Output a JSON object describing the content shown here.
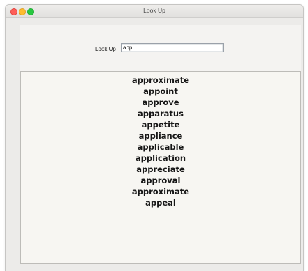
{
  "window": {
    "title": "Look Up"
  },
  "lookup": {
    "label": "Look Up",
    "value": "app"
  },
  "results": [
    "approximate",
    "appoint",
    "approve",
    "apparatus",
    "appetite",
    "appliance",
    "applicable",
    "application",
    "appreciate",
    "approval",
    "approximate",
    "appeal"
  ],
  "colors": {
    "close": "#fe5f58",
    "minimize": "#febc2e",
    "zoom": "#28c840",
    "window_bg": "#ecebe9",
    "results_bg": "#f7f6f2"
  }
}
